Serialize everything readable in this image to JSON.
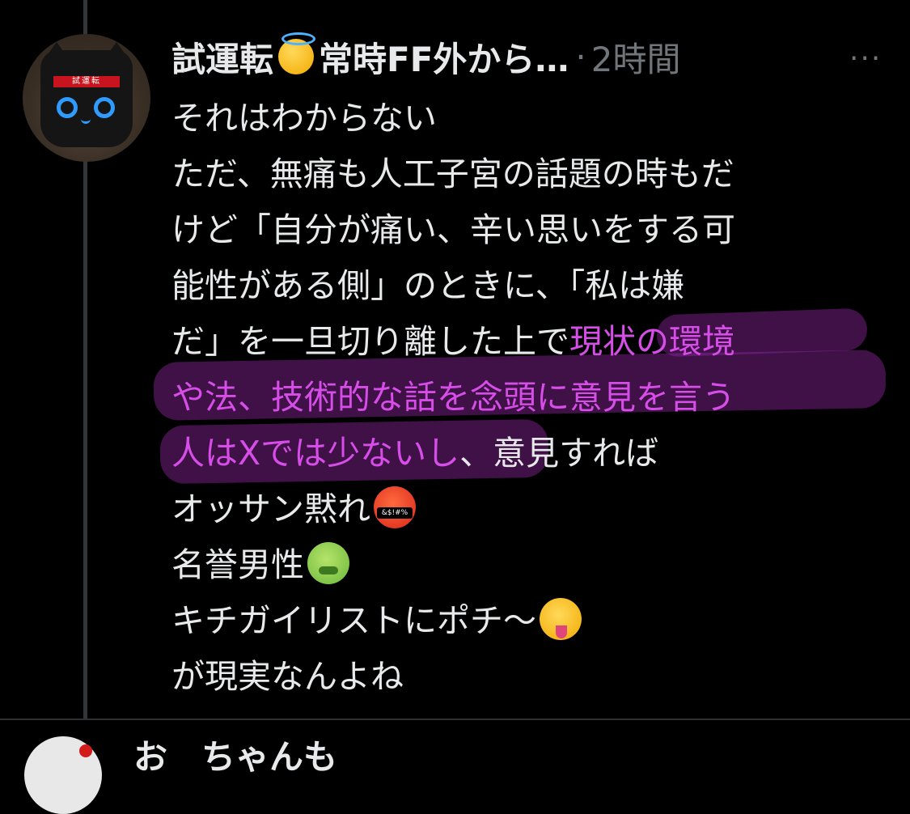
{
  "tweet": {
    "author_name": "試運転",
    "author_name_suffix": "常時FF外から…",
    "separator": "·",
    "time": "2時間",
    "more": "···",
    "avatar_label": "試運転",
    "lines": [
      {
        "text": "それはわからない"
      },
      {
        "text": "ただ、無痛も人工子宮の話題の時もだ"
      },
      {
        "text": "けど「自分が痛い、辛い思いをする可"
      },
      {
        "text": "能性がある側」のときに、「私は嫌"
      },
      {
        "pre": "だ」を一旦切り離した上で",
        "hl": "現状の環境"
      },
      {
        "hl": "や法、技術的な話を念頭に意見を言う"
      },
      {
        "hl": "人はXでは少ないし",
        "post": "、意見すれば"
      },
      {
        "text": "オッサン黙れ"
      },
      {
        "text": "名誉男性"
      },
      {
        "text": "キチガイリストにポチ〜"
      },
      {
        "text": "が現実なんよね"
      }
    ],
    "emoji": {
      "halo": "smiling-face-with-halo",
      "angry": "face-with-symbols-on-mouth",
      "sick": "nauseated-face",
      "zany": "zany-face"
    },
    "highlight_color": "#d64de8"
  },
  "next_tweet": {
    "author_name": "お　ちゃんも"
  }
}
